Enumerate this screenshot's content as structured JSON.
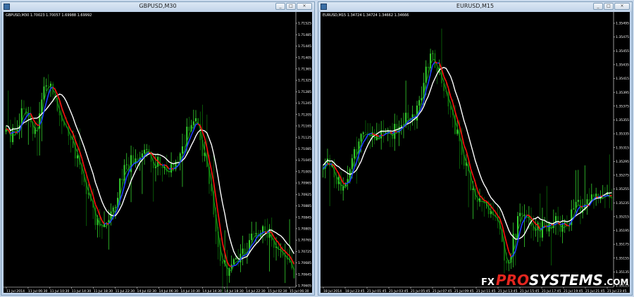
{
  "colors": {
    "background": "#000000",
    "bull": "#34d02e",
    "bear": "#0b6b09",
    "ma_white": "#ffffff",
    "ma_red": "#ff1010",
    "ma_blue": "#1f3fff",
    "ma_green": "#1aa51a"
  },
  "brand": {
    "fx": "FX",
    "pro": "PRO",
    "sys": "SYSTEMS",
    "com": ".COM"
  },
  "charts": [
    {
      "id": "gbp",
      "title": "GBPUSD,M30",
      "info": "GBPUSD,M30  1.70023 1.70057 1.69988 1.69992",
      "buttons": [
        "_",
        "□",
        "×"
      ],
      "y_ticks": [
        "1.71525",
        "1.71485",
        "1.71445",
        "1.71405",
        "1.71365",
        "1.71325",
        "1.71285",
        "1.71245",
        "1.71205",
        "1.71165",
        "1.71125",
        "1.71085",
        "1.71045",
        "1.71005",
        "1.70965",
        "1.70925",
        "1.70885",
        "1.70845",
        "1.70805",
        "1.70765",
        "1.70725",
        "1.70685",
        "1.70645",
        "1.70605"
      ],
      "x_ticks": [
        "11 Jul 2014",
        "11 Jul 06:30",
        "11 Jul 10:30",
        "11 Jul 14:30",
        "11 Jul 18:30",
        "11 Jul 22:30",
        "14 Jul 02:30",
        "14 Jul 06:30",
        "14 Jul 10:30",
        "14 Jul 14:30",
        "14 Jul 18:30",
        "14 Jul 22:30",
        "15 Jul 02:30",
        "15 Jul 06:30"
      ],
      "shape": [
        0.58,
        0.56,
        0.6,
        0.64,
        0.65,
        0.62,
        0.57,
        0.69,
        0.75,
        0.77,
        0.7,
        0.62,
        0.58,
        0.56,
        0.52,
        0.46,
        0.4,
        0.33,
        0.27,
        0.23,
        0.22,
        0.27,
        0.3,
        0.36,
        0.42,
        0.45,
        0.48,
        0.5,
        0.52,
        0.5,
        0.47,
        0.48,
        0.46,
        0.44,
        0.43,
        0.48,
        0.5,
        0.57,
        0.63,
        0.6,
        0.54,
        0.45,
        0.34,
        0.2,
        0.12,
        0.07,
        0.06,
        0.09,
        0.12,
        0.14,
        0.17,
        0.19,
        0.21,
        0.22,
        0.19,
        0.16,
        0.14,
        0.12,
        0.1,
        0.02
      ]
    },
    {
      "id": "eur",
      "title": "EURUSD,M15",
      "info": "EURUSD,M15  1.34724 1.34724 1.34662 1.34666",
      "buttons": [
        "_",
        "□",
        "×"
      ],
      "y_ticks": [
        "1.35495",
        "1.35475",
        "1.35455",
        "1.35435",
        "1.35415",
        "1.35395",
        "1.35375",
        "1.35355",
        "1.35335",
        "1.35315",
        "1.35295",
        "1.35275",
        "1.35255",
        "1.35235",
        "1.35215",
        "1.35195",
        "1.35175",
        "1.35155",
        "1.35135",
        "1.35115"
      ],
      "x_ticks": [
        "18 Jul 2014",
        "18 Jul 23:45",
        "21 Jul 01:45",
        "21 Jul 03:45",
        "21 Jul 05:45",
        "21 Jul 07:45",
        "21 Jul 09:45",
        "21 Jul 11:45",
        "21 Jul 13:45",
        "21 Jul 15:45",
        "21 Jul 17:45",
        "21 Jul 19:45",
        "21 Jul 21:45",
        "21 Jul 23:45"
      ],
      "shape": [
        0.44,
        0.46,
        0.43,
        0.4,
        0.38,
        0.42,
        0.48,
        0.52,
        0.55,
        0.56,
        0.55,
        0.57,
        0.58,
        0.57,
        0.56,
        0.59,
        0.62,
        0.63,
        0.61,
        0.65,
        0.72,
        0.8,
        0.85,
        0.84,
        0.78,
        0.72,
        0.66,
        0.6,
        0.52,
        0.45,
        0.4,
        0.35,
        0.34,
        0.31,
        0.3,
        0.26,
        0.2,
        0.12,
        0.11,
        0.18,
        0.26,
        0.27,
        0.26,
        0.23,
        0.21,
        0.22,
        0.24,
        0.25,
        0.23,
        0.24,
        0.25,
        0.27,
        0.3,
        0.31,
        0.3,
        0.32,
        0.34,
        0.36,
        0.34,
        0.33
      ]
    }
  ]
}
